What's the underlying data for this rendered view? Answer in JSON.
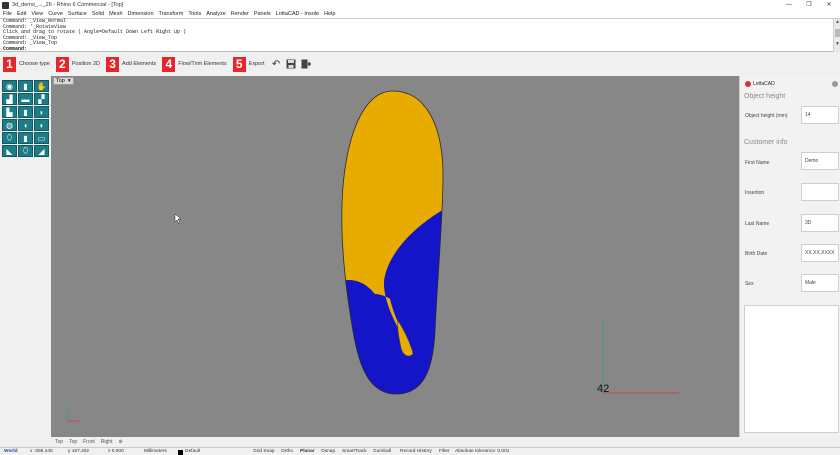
{
  "window": {
    "title": "3d_demo_..._26 - Rhino 6 Commercial - [Top]",
    "controls": [
      "—",
      "❐",
      "✕"
    ]
  },
  "menu": [
    "File",
    "Edit",
    "View",
    "Curve",
    "Surface",
    "Solid",
    "Mesh",
    "Dimension",
    "Transform",
    "Tools",
    "Analyze",
    "Render",
    "Panels",
    "LottaCAD - Insole",
    "Help"
  ],
  "command_history": [
    "Command: _View_Normal",
    "Command: '_RotateView",
    "Click and drag to rotate ( Angle=Default  Down  Left  Right  Up )",
    "Command: _View_Top",
    "Command: _View_Top"
  ],
  "command_prompt": "Command:",
  "toolbar": {
    "steps": [
      {
        "num": "1",
        "label": "Choose type"
      },
      {
        "num": "2",
        "label": "Position 2D"
      },
      {
        "num": "3",
        "label": "Add Elements"
      },
      {
        "num": "4",
        "label": "Flow/Trim Elements"
      },
      {
        "num": "5",
        "label": "Export"
      }
    ],
    "icons": [
      "undo-icon",
      "save-icon",
      "exit-icon"
    ]
  },
  "viewport": {
    "name": "Top",
    "axis_label": "42",
    "colors": {
      "background": "#878787",
      "insole_top": "#e8ac00",
      "insole_bottom": "#1414c8"
    }
  },
  "right_panel": {
    "header": "LottaCAD",
    "section1": "Object height",
    "object_height_label": "Object height (mm)",
    "object_height_value": "14",
    "section2": "Customer info",
    "fields": [
      {
        "label": "First Name",
        "value": "Demo"
      },
      {
        "label": "Insertion",
        "value": ""
      },
      {
        "label": "Last Name",
        "value": "3D"
      },
      {
        "label": "Birth Date",
        "value": "XX.XX.XXXX"
      },
      {
        "label": "Sex",
        "value": "Male"
      }
    ]
  },
  "view_tabs": [
    "Top",
    "Top",
    "Front",
    "Right",
    "⊕"
  ],
  "status": {
    "cplane": "World",
    "x": "x -295.440",
    "y": "y 167.402",
    "z": "z 0.000",
    "units": "Millimeters",
    "layer": "Default",
    "toggles": [
      "Grid Snap",
      "Ortho",
      "Planar",
      "Osnap",
      "SmartTrack",
      "Gumball",
      "Record History",
      "Filter"
    ],
    "tolerance": "Absolute tolerance: 0.001"
  }
}
